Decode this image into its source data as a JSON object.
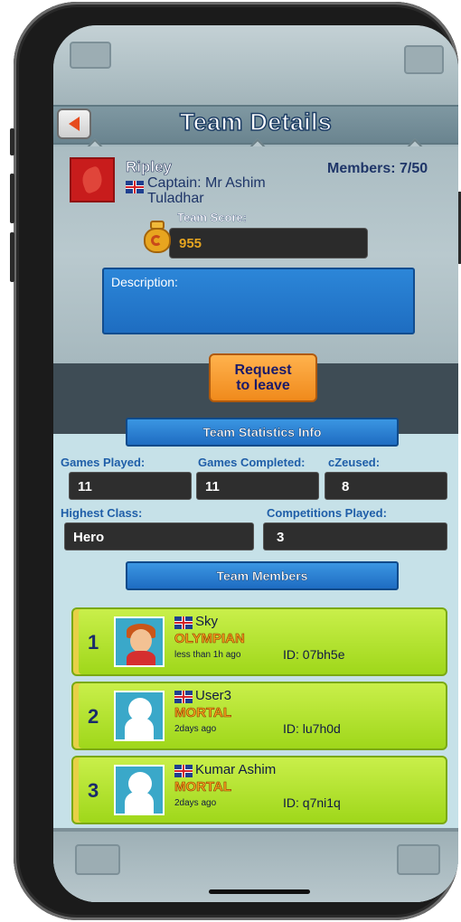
{
  "header": {
    "title": "Team Details"
  },
  "team": {
    "name": "Ripley",
    "members_label": "Members: ",
    "members_value": "7/50",
    "captain": "Captain: Mr Ashim Tuladhar",
    "score_label": "Team Score:",
    "score": "955",
    "description_label": "Description:"
  },
  "actions": {
    "leave_label_1": "Request",
    "leave_label_2": "to leave"
  },
  "stats": {
    "title": "Team Statistics Info",
    "games_played_label": "Games Played:",
    "games_played": "11",
    "games_completed_label": "Games Completed:",
    "games_completed": "11",
    "czeused_label": "cZeused:",
    "czeused": "8",
    "highest_class_label": "Highest Class:",
    "highest_class": "Hero",
    "competitions_label": "Competitions Played:",
    "competitions": "3"
  },
  "members": {
    "title": "Team Members",
    "items": [
      {
        "rank": "1",
        "name": "Sky",
        "class": "OLYMPIAN",
        "last_seen": "less than 1h ago",
        "id": "ID: 07bh5e"
      },
      {
        "rank": "2",
        "name": "User3",
        "class": "MORTAL",
        "last_seen": "2days ago",
        "id": "ID: lu7h0d"
      },
      {
        "rank": "3",
        "name": "Kumar Ashim",
        "class": "MORTAL",
        "last_seen": "2days ago",
        "id": "ID: q7ni1q"
      }
    ]
  },
  "colors": {
    "accent": "#1e6cc2",
    "card": "#b2e32e",
    "button": "#f08a1c"
  },
  "icons": [
    "back-arrow-icon",
    "team-logo-icon",
    "uk-flag-icon",
    "score-pot-icon",
    "avatar-icon"
  ]
}
